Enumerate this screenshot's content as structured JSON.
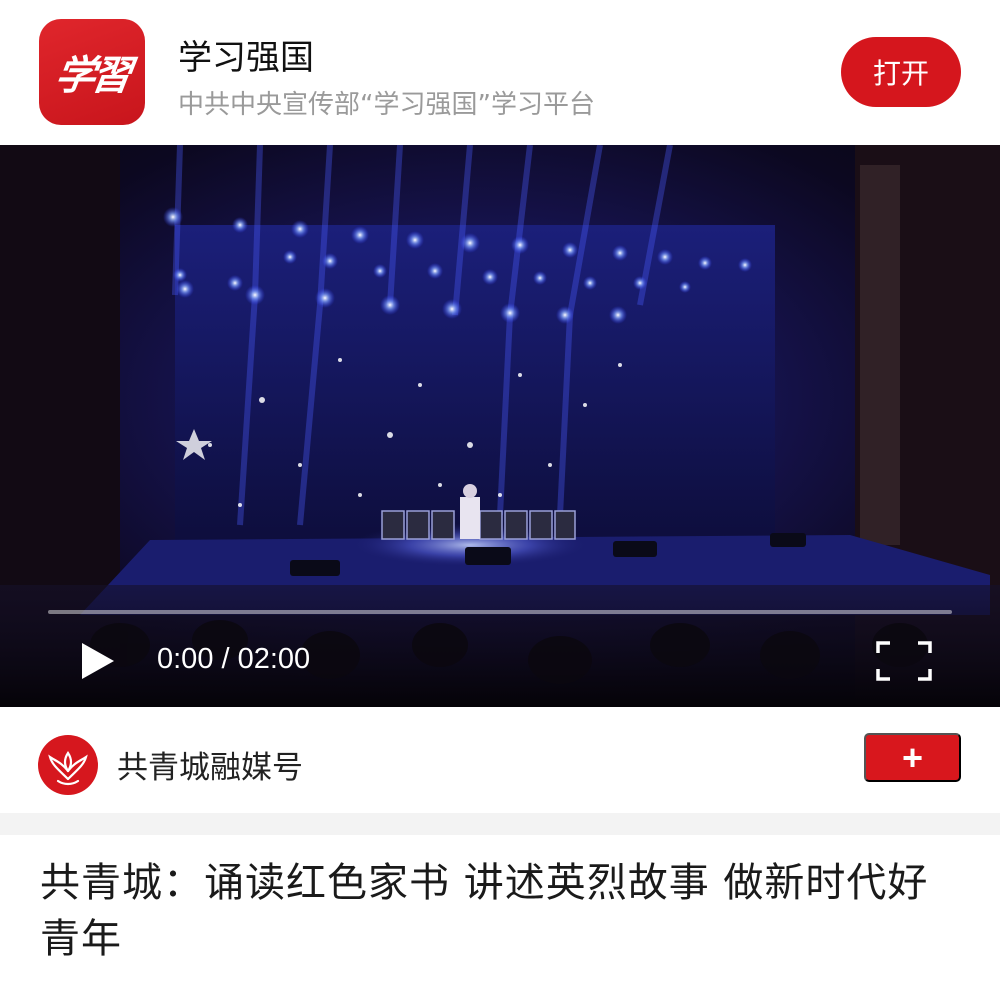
{
  "banner": {
    "logo_text": "学習",
    "app_name": "学习强国",
    "subtitle": "中共中央宣传部“学习强国”学习平台",
    "open_label": "打开",
    "accent_color": "#d5161d"
  },
  "video": {
    "current_time": "0:00",
    "separator": "/",
    "duration": "02:00",
    "time_text": "0:00 / 02:00",
    "progress_fraction": 0.0,
    "play_icon": "play-icon",
    "fullscreen_icon": "fullscreen-icon"
  },
  "author": {
    "name": "共青城融媒号",
    "avatar_icon": "phoenix-logo",
    "follow_label": "+"
  },
  "article": {
    "title": "共青城：诵读红色家书 讲述英烈故事 做新时代好青年"
  }
}
